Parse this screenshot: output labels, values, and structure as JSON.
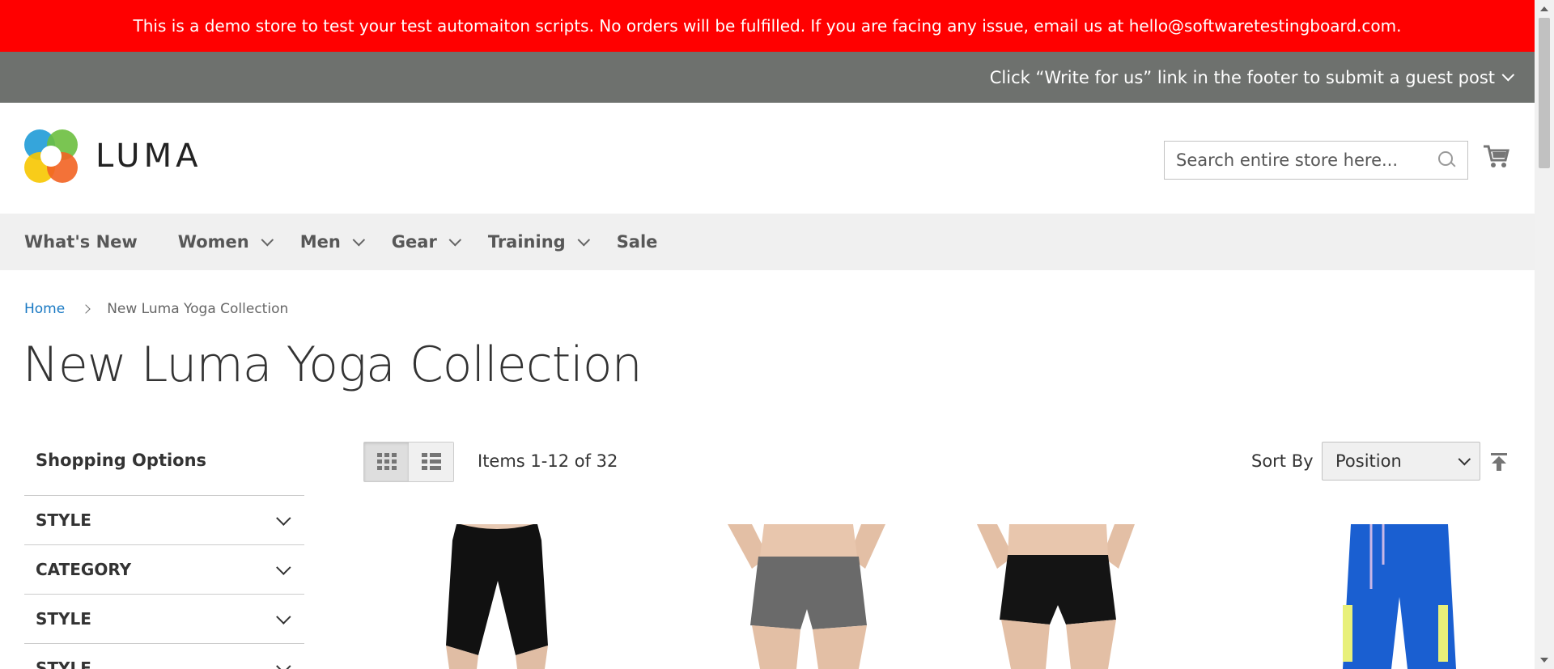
{
  "demo_banner": {
    "text": "This is a demo store to test your test automaiton scripts. No orders will be fulfilled. If you are facing any issue, email us at hello@softwaretestingboard.com."
  },
  "guest_bar": {
    "text": "Click “Write for us” link in the footer to submit a guest post"
  },
  "logo": {
    "text": "LUMA"
  },
  "search": {
    "placeholder": "Search entire store here...",
    "icon": "search-icon"
  },
  "cart": {
    "icon": "cart-icon"
  },
  "nav": {
    "items": [
      {
        "label": "What's New",
        "has_dropdown": false
      },
      {
        "label": "Women",
        "has_dropdown": true
      },
      {
        "label": "Men",
        "has_dropdown": true
      },
      {
        "label": "Gear",
        "has_dropdown": true
      },
      {
        "label": "Training",
        "has_dropdown": true
      },
      {
        "label": "Sale",
        "has_dropdown": false
      }
    ]
  },
  "breadcrumbs": {
    "home": "Home",
    "current": "New Luma Yoga Collection"
  },
  "page": {
    "title": "New Luma Yoga Collection"
  },
  "sidebar": {
    "title": "Shopping Options",
    "filters": [
      "STYLE",
      "CATEGORY",
      "STYLE",
      "STYLE"
    ]
  },
  "toolbar": {
    "modes": [
      {
        "name": "grid",
        "icon": "grid-icon",
        "active": true
      },
      {
        "name": "list",
        "icon": "list-icon",
        "active": false
      }
    ],
    "amount": "Items 1-12 of 32",
    "sort_label": "Sort By",
    "sort_value": "Position",
    "sort_direction_icon": "arrow-up-icon"
  },
  "colors": {
    "banner": "#ff0000",
    "guest_bar": "#6e716e",
    "nav_bg": "#f0f0f0",
    "link": "#1979c3"
  }
}
